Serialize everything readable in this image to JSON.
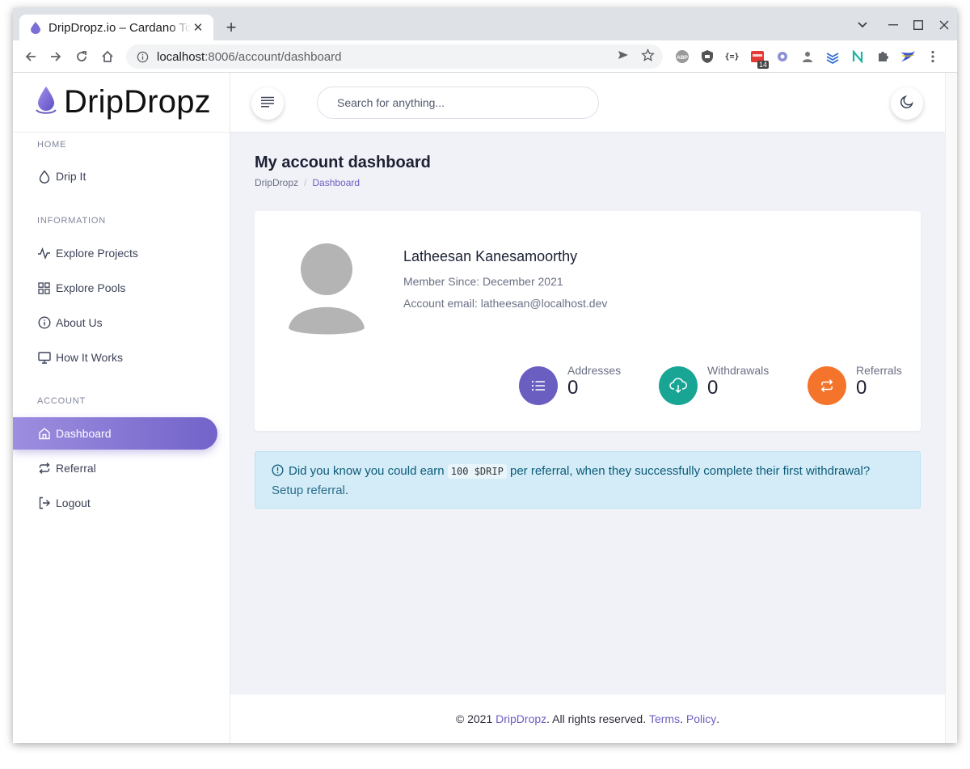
{
  "browser": {
    "tab_title": "DripDropz.io – Cardano Token Distribution",
    "url_host": "localhost",
    "url_rest": ":8006/account/dashboard",
    "extension_badge": "14"
  },
  "sidebar": {
    "brand": "DripDropz",
    "sections": {
      "home": "HOME",
      "information": "INFORMATION",
      "account": "ACCOUNT"
    },
    "items": {
      "drip_it": "Drip It",
      "explore_projects": "Explore Projects",
      "explore_pools": "Explore Pools",
      "about_us": "About Us",
      "how_it_works": "How It Works",
      "dashboard": "Dashboard",
      "referral": "Referral",
      "logout": "Logout"
    }
  },
  "header": {
    "search_placeholder": "Search for anything..."
  },
  "main": {
    "title": "My account dashboard",
    "breadcrumb": [
      "DripDropz",
      "Dashboard"
    ],
    "profile": {
      "name": "Latheesan Kanesamoorthy",
      "member_since": "Member Since: December 2021",
      "email": "Account email: latheesan@localhost.dev"
    },
    "stats": [
      {
        "label": "Addresses",
        "value": "0",
        "color": "#6a5fc1",
        "icon": "list-icon"
      },
      {
        "label": "Withdrawals",
        "value": "0",
        "color": "#18a594",
        "icon": "cloud-download-icon"
      },
      {
        "label": "Referrals",
        "value": "0",
        "color": "#f4742b",
        "icon": "repeat-icon"
      }
    ],
    "alert": {
      "before": "Did you know you could earn",
      "code": "100 $DRIP",
      "after": "per referral, when they successfully complete their first withdrawal?",
      "link": "Setup referral",
      "end": "."
    }
  },
  "footer": {
    "copyright": "© 2021",
    "brand": "DripDropz",
    "rights": ". All rights reserved.",
    "terms": "Terms",
    "dot": ".",
    "policy": "Policy",
    "end": "."
  }
}
